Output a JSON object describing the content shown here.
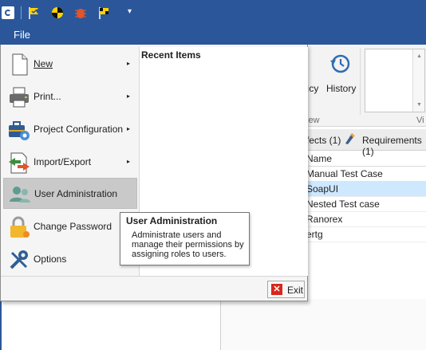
{
  "quick_access": {
    "icons": [
      "app-icon",
      "flag-check-icon",
      "test-run-icon",
      "bug-icon",
      "flag-compare-icon"
    ],
    "dropdown_glyph": "▾"
  },
  "ribbon": {
    "file_tab": "File",
    "partial_button_label": "ıcy",
    "history_label": "History",
    "group_label_view": "iew",
    "group_label_vi": "Vi"
  },
  "background_panel": {
    "tabs": [
      {
        "label": "fects (1)"
      },
      {
        "label": "Requirements (1)"
      }
    ],
    "column_header": "Name",
    "rows": [
      {
        "name": "Manual Test Case",
        "selected": false
      },
      {
        "name": "SoapUI",
        "selected": true
      },
      {
        "name": "Nested Test case",
        "selected": false
      },
      {
        "name": "Ranorex",
        "selected": false
      },
      {
        "name": "ertg",
        "selected": false
      }
    ]
  },
  "file_menu": {
    "items": [
      {
        "label": "New",
        "has_submenu": true
      },
      {
        "label": "Print...",
        "has_submenu": true
      },
      {
        "label": "Project Configuration",
        "has_submenu": true
      },
      {
        "label": "Import/Export",
        "has_submenu": true
      },
      {
        "label": "User Administration",
        "has_submenu": false,
        "hovered": true
      },
      {
        "label": "Change Password",
        "has_submenu": false
      },
      {
        "label": "Options",
        "has_submenu": false
      }
    ],
    "recent_items_title": "Recent Items",
    "exit_label": "Exit",
    "submenu_arrow": "▸"
  },
  "tooltip": {
    "title": "User Administration",
    "description": "Administrate users and manage their permissions by assigning roles to users."
  },
  "colors": {
    "accent": "#2b579a",
    "menu_bg": "#f5f5f5",
    "hover": "#c9c9c9",
    "selected_row": "#cde8ff",
    "exit_red": "#d9261c"
  }
}
